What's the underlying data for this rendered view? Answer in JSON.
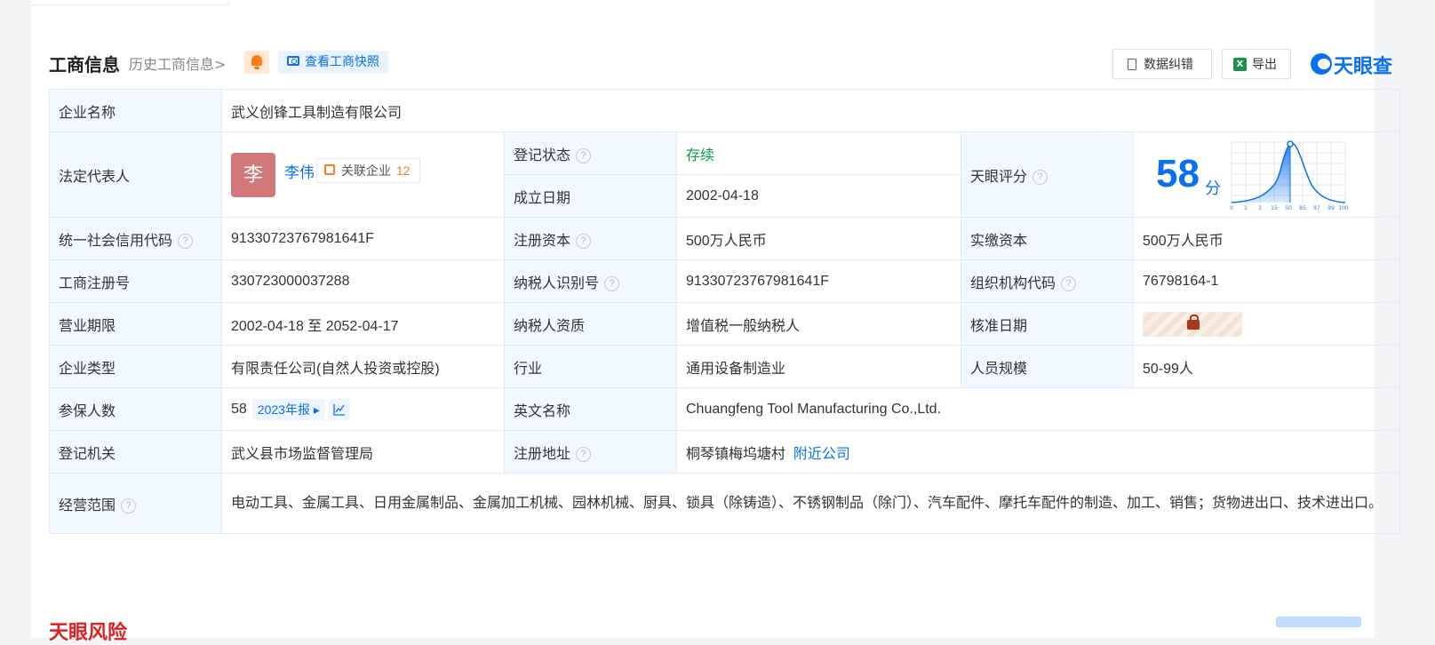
{
  "header": {
    "title": "工商信息",
    "history_link": "历史工商信息>",
    "snapshot_button": "查看工商快照",
    "correct_button": "数据纠错",
    "export_button": "导出",
    "logo_text": "天眼查"
  },
  "company": {
    "name_label": "企业名称",
    "name": "武义创锋工具制造有限公司",
    "legal_rep_label": "法定代表人",
    "legal_rep_avatar": "李",
    "legal_rep_name": "李伟",
    "related_companies_label": "关联企业",
    "related_companies_count": "12",
    "reg_status_label": "登记状态",
    "reg_status": "存续",
    "found_date_label": "成立日期",
    "found_date": "2002-04-18",
    "score_label": "天眼评分",
    "score": "58",
    "score_unit": "分",
    "score_axis": [
      "0",
      "1",
      "3",
      "15",
      "50",
      "85",
      "97",
      "99",
      "100"
    ],
    "credit_code_label": "统一社会信用代码",
    "credit_code": "91330723767981641F",
    "reg_capital_label": "注册资本",
    "reg_capital": "500万人民币",
    "paid_capital_label": "实缴资本",
    "paid_capital": "500万人民币",
    "reg_no_label": "工商注册号",
    "reg_no": "330723000037288",
    "taxpayer_id_label": "纳税人识别号",
    "taxpayer_id": "91330723767981641F",
    "org_code_label": "组织机构代码",
    "org_code": "76798164-1",
    "term_label": "营业期限",
    "term": "2002-04-18 至 2052-04-17",
    "taxpayer_qual_label": "纳税人资质",
    "taxpayer_qual": "增值税一般纳税人",
    "approve_date_label": "核准日期",
    "type_label": "企业类型",
    "type": "有限责任公司(自然人投资或控股)",
    "industry_label": "行业",
    "industry": "通用设备制造业",
    "staff_size_label": "人员规模",
    "staff_size": "50-99人",
    "insured_label": "参保人数",
    "insured": "58",
    "insured_year": "2023年报",
    "english_name_label": "英文名称",
    "english_name": "Chuangfeng Tool Manufacturing Co.,Ltd.",
    "authority_label": "登记机关",
    "authority": "武义县市场监督管理局",
    "address_label": "注册地址",
    "address": "桐琴镇梅坞塘村",
    "nearby_link": "附近公司",
    "scope_label": "经营范围",
    "scope": "电动工具、金属工具、日用金属制品、金属加工机械、园林机械、厨具、锁具（除铸造）、不锈钢制品（除门）、汽车配件、摩托车配件的制造、加工、销售；货物进出口、技术进出口。"
  },
  "next_section": {
    "title": "天眼风险"
  },
  "colors": {
    "accent": "#0a6ff0",
    "label_bg": "#f2f8ff",
    "status_green": "#0b9b4a",
    "related_orange": "#ff7a1a"
  }
}
